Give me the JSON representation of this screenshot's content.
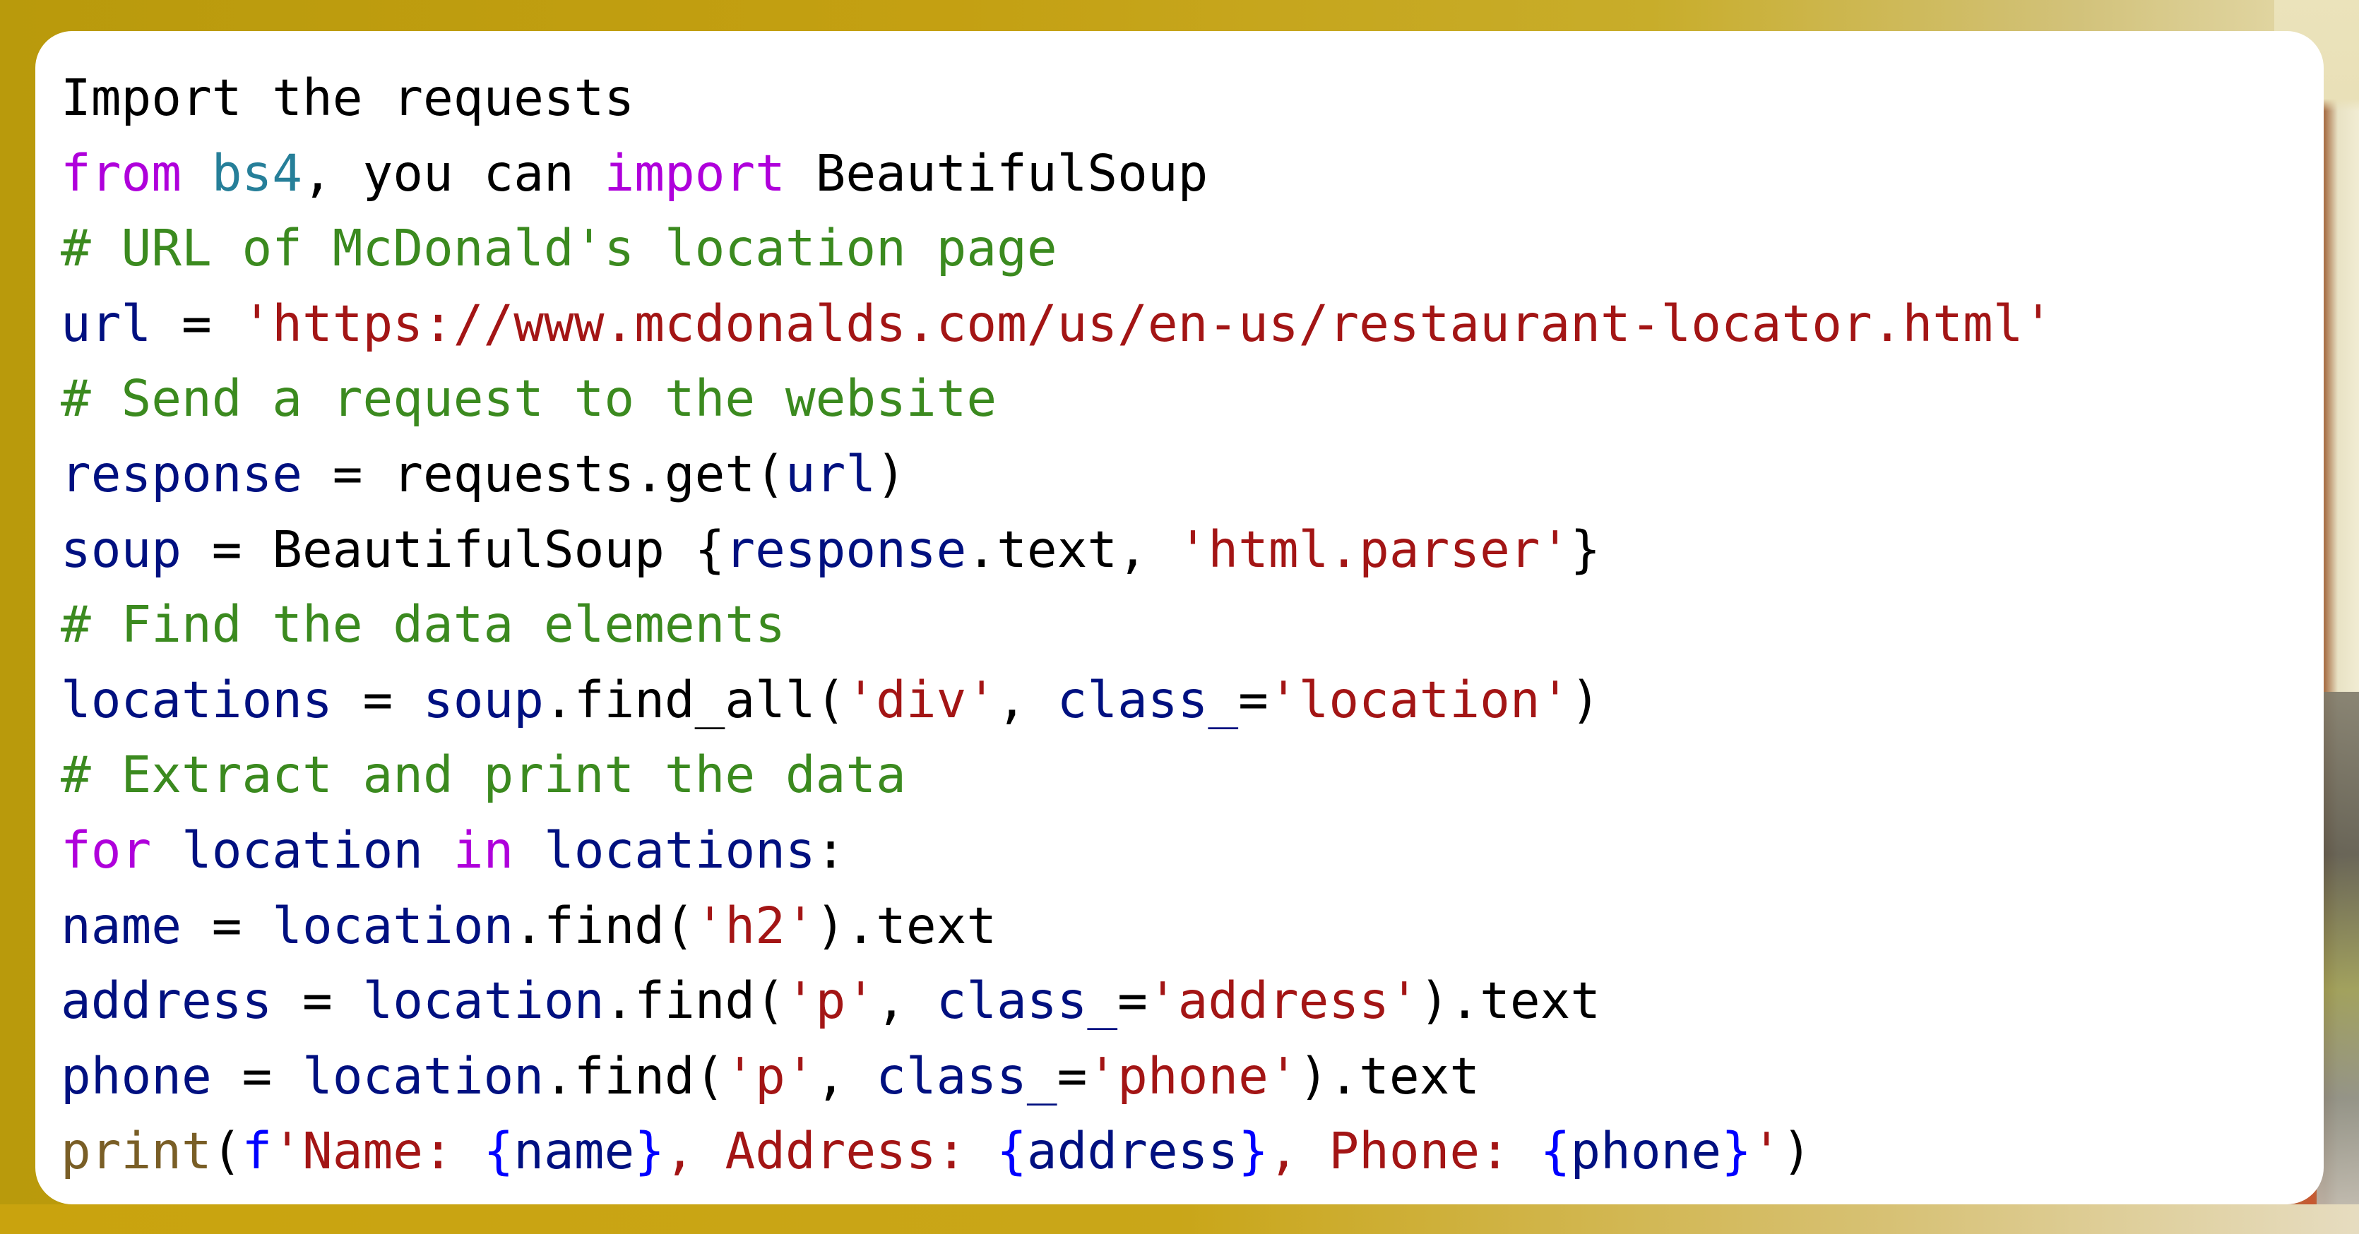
{
  "theme": {
    "background_gold": "#c4a012",
    "card_background": "#ffffff",
    "token_colors": {
      "plain": "#000000",
      "keyword": "#af00db",
      "module": "#267f99",
      "comment": "#3b8a1f",
      "var": "#001080",
      "string": "#a31515",
      "func": "#795e26",
      "fprefix": "#0000ff",
      "brace": "#0000ff"
    }
  },
  "code": {
    "lines": [
      [
        {
          "t": "plain",
          "s": "Import the requests"
        }
      ],
      [
        {
          "t": "keyword",
          "s": "from"
        },
        {
          "t": "plain",
          "s": " "
        },
        {
          "t": "module",
          "s": "bs4"
        },
        {
          "t": "plain",
          "s": ", you can "
        },
        {
          "t": "keyword",
          "s": "import"
        },
        {
          "t": "plain",
          "s": " BeautifulSoup"
        }
      ],
      [
        {
          "t": "comment",
          "s": "# URL of McDonald's location page"
        }
      ],
      [
        {
          "t": "var",
          "s": "url"
        },
        {
          "t": "plain",
          "s": " = "
        },
        {
          "t": "string",
          "s": "'https://www.mcdonalds.com/us/en-us/restaurant-locator.html'"
        }
      ],
      [
        {
          "t": "comment",
          "s": "# Send a request to the website"
        }
      ],
      [
        {
          "t": "var",
          "s": "response"
        },
        {
          "t": "plain",
          "s": " = requests.get("
        },
        {
          "t": "var",
          "s": "url"
        },
        {
          "t": "plain",
          "s": ")"
        }
      ],
      [
        {
          "t": "var",
          "s": "soup"
        },
        {
          "t": "plain",
          "s": " = BeautifulSoup {"
        },
        {
          "t": "var",
          "s": "response"
        },
        {
          "t": "plain",
          "s": ".text, "
        },
        {
          "t": "string",
          "s": "'html.parser'"
        },
        {
          "t": "plain",
          "s": "}"
        }
      ],
      [
        {
          "t": "comment",
          "s": "# Find the data elements"
        }
      ],
      [
        {
          "t": "var",
          "s": "locations"
        },
        {
          "t": "plain",
          "s": " = "
        },
        {
          "t": "var",
          "s": "soup"
        },
        {
          "t": "plain",
          "s": ".find_all("
        },
        {
          "t": "string",
          "s": "'div'"
        },
        {
          "t": "plain",
          "s": ", "
        },
        {
          "t": "var",
          "s": "class_"
        },
        {
          "t": "plain",
          "s": "="
        },
        {
          "t": "string",
          "s": "'location'"
        },
        {
          "t": "plain",
          "s": ")"
        }
      ],
      [
        {
          "t": "comment",
          "s": "# Extract and print the data"
        }
      ],
      [
        {
          "t": "keyword",
          "s": "for"
        },
        {
          "t": "plain",
          "s": " "
        },
        {
          "t": "var",
          "s": "location"
        },
        {
          "t": "plain",
          "s": " "
        },
        {
          "t": "keyword",
          "s": "in"
        },
        {
          "t": "plain",
          "s": " "
        },
        {
          "t": "var",
          "s": "locations"
        },
        {
          "t": "plain",
          "s": ":"
        }
      ],
      [
        {
          "t": "var",
          "s": "name"
        },
        {
          "t": "plain",
          "s": " = "
        },
        {
          "t": "var",
          "s": "location"
        },
        {
          "t": "plain",
          "s": ".find("
        },
        {
          "t": "string",
          "s": "'h2'"
        },
        {
          "t": "plain",
          "s": ").text"
        }
      ],
      [
        {
          "t": "var",
          "s": "address"
        },
        {
          "t": "plain",
          "s": " = "
        },
        {
          "t": "var",
          "s": "location"
        },
        {
          "t": "plain",
          "s": ".find("
        },
        {
          "t": "string",
          "s": "'p'"
        },
        {
          "t": "plain",
          "s": ", "
        },
        {
          "t": "var",
          "s": "class_"
        },
        {
          "t": "plain",
          "s": "="
        },
        {
          "t": "string",
          "s": "'address'"
        },
        {
          "t": "plain",
          "s": ").text"
        }
      ],
      [
        {
          "t": "var",
          "s": "phone"
        },
        {
          "t": "plain",
          "s": " = "
        },
        {
          "t": "var",
          "s": "location"
        },
        {
          "t": "plain",
          "s": ".find("
        },
        {
          "t": "string",
          "s": "'p'"
        },
        {
          "t": "plain",
          "s": ", "
        },
        {
          "t": "var",
          "s": "class_"
        },
        {
          "t": "plain",
          "s": "="
        },
        {
          "t": "string",
          "s": "'phone'"
        },
        {
          "t": "plain",
          "s": ").text"
        }
      ],
      [
        {
          "t": "func",
          "s": "print"
        },
        {
          "t": "plain",
          "s": "("
        },
        {
          "t": "fprefix",
          "s": "f"
        },
        {
          "t": "string",
          "s": "'Name: "
        },
        {
          "t": "brace",
          "s": "{"
        },
        {
          "t": "var",
          "s": "name"
        },
        {
          "t": "brace",
          "s": "}"
        },
        {
          "t": "string",
          "s": ", Address: "
        },
        {
          "t": "brace",
          "s": "{"
        },
        {
          "t": "var",
          "s": "address"
        },
        {
          "t": "brace",
          "s": "}"
        },
        {
          "t": "string",
          "s": ", Phone: "
        },
        {
          "t": "brace",
          "s": "{"
        },
        {
          "t": "var",
          "s": "phone"
        },
        {
          "t": "brace",
          "s": "}"
        },
        {
          "t": "string",
          "s": "'"
        },
        {
          "t": "plain",
          "s": ")"
        }
      ]
    ]
  }
}
